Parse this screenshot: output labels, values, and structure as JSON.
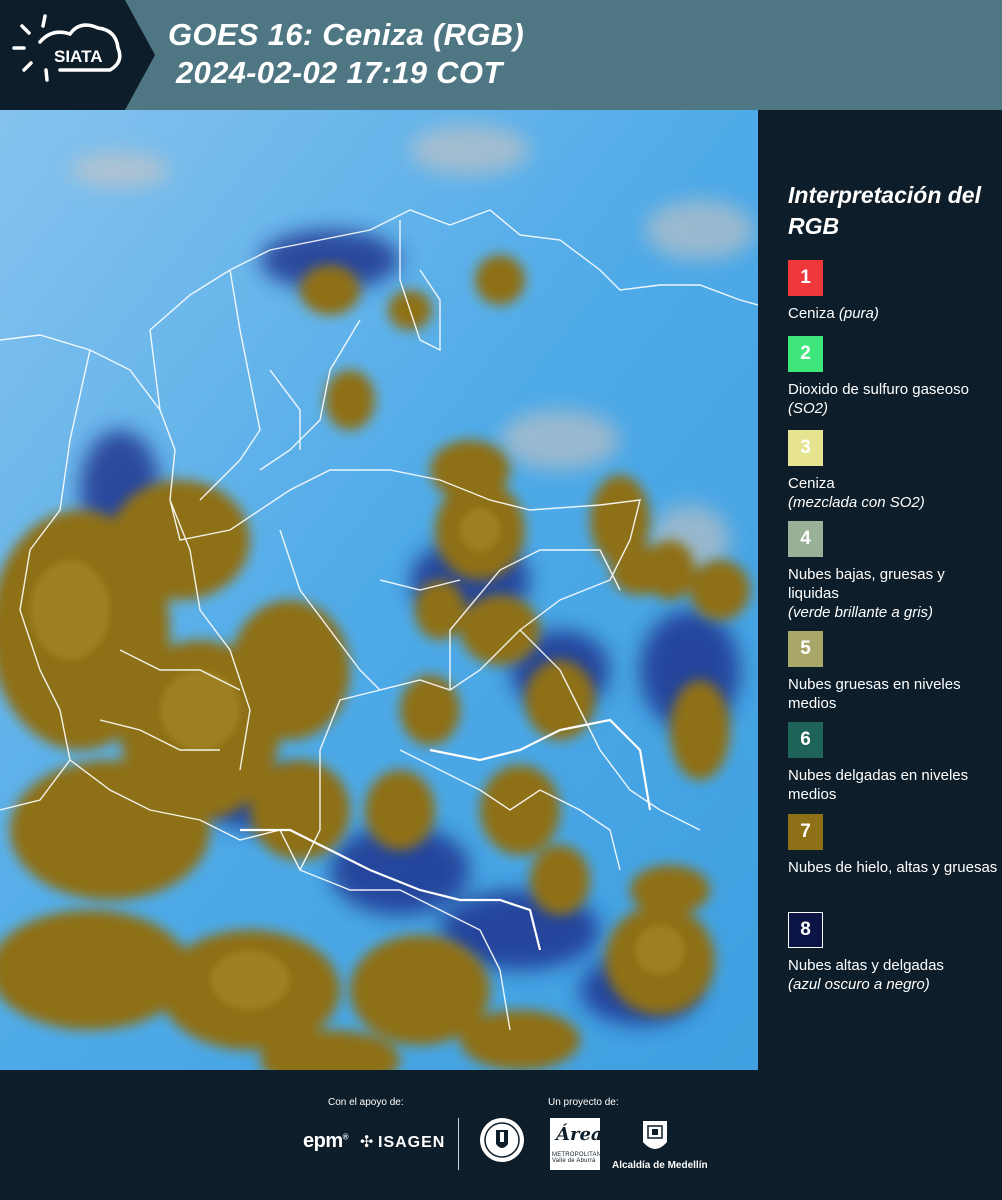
{
  "header": {
    "logo_text": "SIATA",
    "title_line1": "GOES 16: Ceniza (RGB)",
    "title_line2": "2024-02-02 17:19 COT",
    "logo_icon": "sun-cloud-icon"
  },
  "legend": {
    "title": "Interpretación del RGB",
    "items": [
      {
        "number": "1",
        "color": "#f0373a",
        "label": "Ceniza",
        "note": "(pura)",
        "note_inline": true
      },
      {
        "number": "2",
        "color": "#3fe67c",
        "label": "Dioxido de sulfuro gaseoso",
        "note": "(SO2)",
        "note_inline": true
      },
      {
        "number": "3",
        "color": "#e6e391",
        "label": "Ceniza",
        "note": "(mezclada con SO2)",
        "note_inline": false
      },
      {
        "number": "4",
        "color": "#98b197",
        "label": "Nubes bajas, gruesas y liquidas",
        "note": "(verde brillante a gris)",
        "note_inline": false
      },
      {
        "number": "5",
        "color": "#a9a66a",
        "label": "Nubes gruesas en niveles medios",
        "note": "",
        "note_inline": false
      },
      {
        "number": "6",
        "color": "#1f6458",
        "label": "Nubes delgadas en niveles medios",
        "note": "",
        "note_inline": false
      },
      {
        "number": "7",
        "color": "#8e7016",
        "label": "Nubes de hielo, altas y gruesas",
        "note": "",
        "note_inline": false
      },
      {
        "number": "8",
        "color": "#0b1445",
        "label": "Nubes altas y delgadas",
        "note": "(azul oscuro a negro)",
        "note_inline": false
      }
    ]
  },
  "footer": {
    "support_label": "Con el apoyo de:",
    "project_label": "Un proyecto de:",
    "sponsor_1": "epm",
    "sponsor_2": "ISAGEN",
    "partner_1": "Área",
    "partner_1_sub": "METROPOLITANA Valle de Aburrá",
    "partner_2": "Alcaldía de Medellín"
  },
  "map": {
    "background_color": "#5aaee6",
    "cloud_color": "#8e7016",
    "border_color": "#ffffff"
  }
}
